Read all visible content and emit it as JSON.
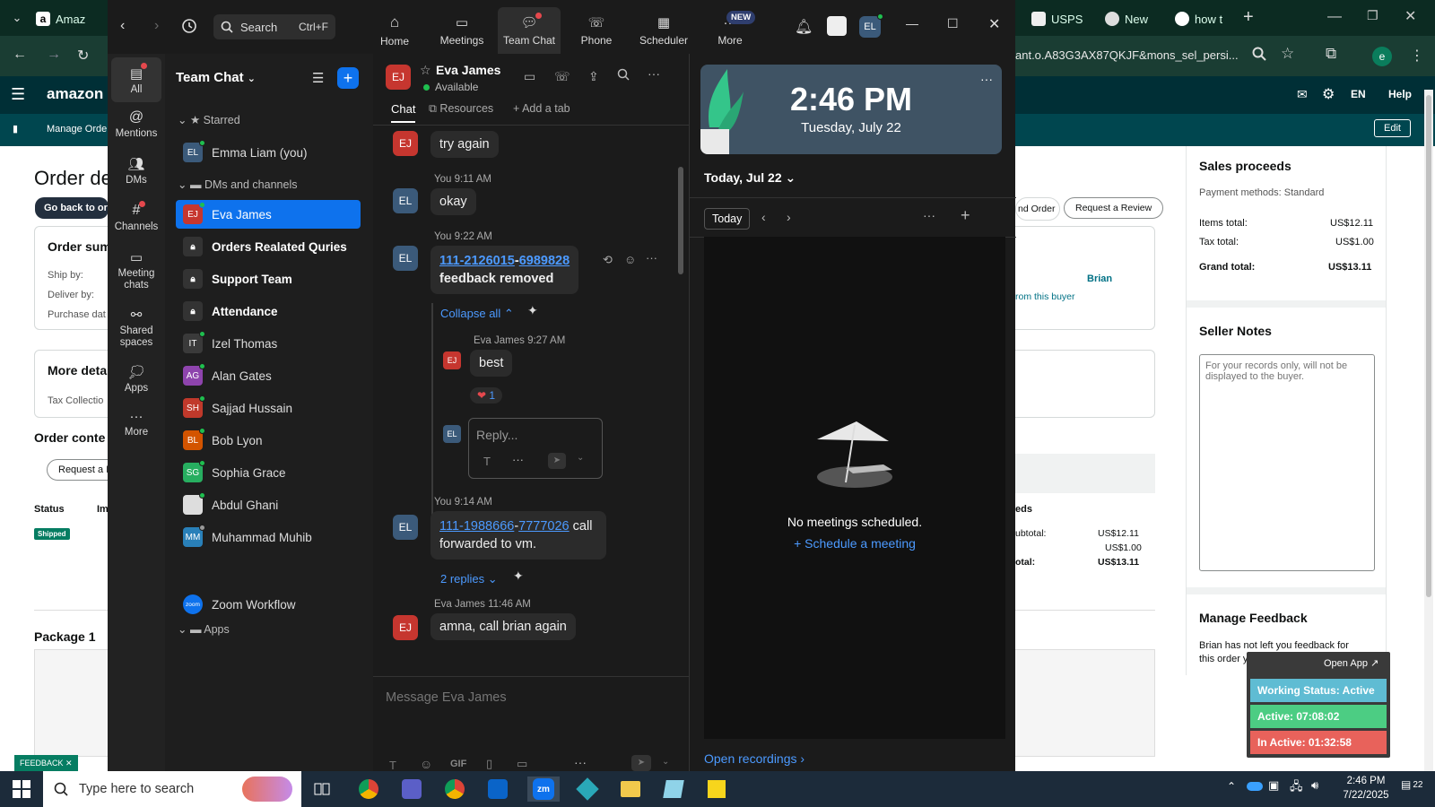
{
  "browser": {
    "tabs": [
      {
        "label": "Amaz"
      },
      {
        "label": "USPS"
      },
      {
        "label": "New"
      },
      {
        "label": "how t"
      }
    ],
    "address": "ant.o.A83G3AX87QKJF&mons_sel_persi...",
    "profile_initial": "e"
  },
  "amazon": {
    "logo": "amazon se",
    "lang": "EN",
    "help": "Help",
    "sub_item": "Manage Order",
    "edit": "Edit",
    "page_title": "Order de",
    "back_btn": "Go back to ord",
    "order_summary": "Order sum",
    "ship_by": "Ship by:",
    "deliver_by": "Deliver by:",
    "purchase_date": "Purchase dat",
    "more_details": "More deta",
    "tax_collection": "Tax Collectio",
    "order_contents": "Order conte",
    "request_btn": "Request a R",
    "col_status": "Status",
    "col_im": "Im",
    "status_badge": "Shipped",
    "package": "Package 1",
    "nd_order": "nd Order",
    "request_review": "Request a Review",
    "buyer_name": "Brian",
    "from_buyer": "rom this buyer",
    "eds": "eds",
    "subtotal_label": "ubtotal:",
    "subtotal_val": "US$12.11",
    "tax_val": "US$1.00",
    "total_label": "otal:",
    "total_val": "US$13.11",
    "sales_proceeds": "Sales proceeds",
    "payment_methods": "Payment methods: Standard",
    "items_total_label": "Items total:",
    "items_total_val": "US$12.11",
    "tax_total_label": "Tax total:",
    "tax_total_val": "US$1.00",
    "grand_total_label": "Grand total:",
    "grand_total_val": "US$13.11",
    "seller_notes": "Seller Notes",
    "notes_placeholder": "For your records only, will not be displayed to the buyer.",
    "manage_feedback": "Manage Feedback",
    "feedback_text": "Brian has not left you feedback for this order yet.",
    "feedback_tab": "FEEDBACK"
  },
  "widget": {
    "open_app": "Open App",
    "working": "Working Status: Active",
    "active": "Active: 07:08:02",
    "inactive": "In Active: 01:32:58"
  },
  "zoom": {
    "search": "Search",
    "search_shortcut": "Ctrl+F",
    "nav": [
      {
        "label": "Home"
      },
      {
        "label": "Meetings"
      },
      {
        "label": "Team Chat"
      },
      {
        "label": "Phone"
      },
      {
        "label": "Scheduler"
      },
      {
        "label": "More"
      }
    ],
    "new_badge": "NEW",
    "user_initials": "EL",
    "rail": [
      {
        "label": "All"
      },
      {
        "label": "Mentions"
      },
      {
        "label": "DMs"
      },
      {
        "label": "Channels"
      },
      {
        "label": "Meeting chats"
      },
      {
        "label": "Shared spaces"
      },
      {
        "label": "Apps"
      },
      {
        "label": "More"
      }
    ],
    "list_title": "Team Chat",
    "starred": "Starred",
    "dms_channels": "DMs and channels",
    "apps_section": "Apps",
    "list": [
      {
        "initials": "EL",
        "name": "Emma Liam (you)"
      },
      {
        "initials": "EJ",
        "name": "Eva James"
      },
      {
        "initials": "",
        "name": "Orders Realated Quries"
      },
      {
        "initials": "",
        "name": "Support Team"
      },
      {
        "initials": "",
        "name": "Attendance"
      },
      {
        "initials": "IT",
        "name": "Izel Thomas"
      },
      {
        "initials": "AG",
        "name": "Alan Gates"
      },
      {
        "initials": "SH",
        "name": "Sajjad Hussain"
      },
      {
        "initials": "BL",
        "name": "Bob Lyon"
      },
      {
        "initials": "SG",
        "name": "Sophia Grace"
      },
      {
        "initials": "",
        "name": "Abdul Ghani"
      },
      {
        "initials": "MM",
        "name": "Muhammad Muhib"
      },
      {
        "initials": "zoom",
        "name": "Zoom Workflow"
      }
    ],
    "chat": {
      "contact_name": "Eva James",
      "contact_initials": "EJ",
      "status": "Available",
      "tab_chat": "Chat",
      "tab_resources": "Resources",
      "tab_add": "Add a tab",
      "msg1": "try again",
      "msg2_time": "You 9:11 AM",
      "msg2": "okay",
      "msg3_time": "You 9:22 AM",
      "msg3_link1": "111-2126015",
      "msg3_dash": "-",
      "msg3_link2": "6989828",
      "msg3_text": "feedback removed",
      "collapse": "Collapse all",
      "reply_author": "Eva James",
      "reply_time": "9:27 AM",
      "reply_msg": "best",
      "reaction_count": "1",
      "reply_placeholder": "Reply...",
      "msg4_time": "You 9:14 AM",
      "msg4_link1": "111-1988666",
      "msg4_dash": "-",
      "msg4_link2": "7777026",
      "msg4_text": " call forwarded to vm.",
      "replies": "2 replies",
      "msg5_author": "Eva James",
      "msg5_time": "11:46 AM",
      "msg5": "amna, call brian again",
      "compose_placeholder": "Message Eva James",
      "gif": "GIF"
    },
    "side": {
      "time": "2:46 PM",
      "date": "Tuesday, July 22",
      "today_hdr": "Today, Jul 22",
      "today_btn": "Today",
      "no_meetings": "No meetings scheduled.",
      "schedule": "Schedule a meeting",
      "recordings": "Open recordings"
    }
  },
  "taskbar": {
    "search": "Type here to search",
    "time": "2:46 PM",
    "date": "7/22/2025",
    "notif": "22"
  }
}
